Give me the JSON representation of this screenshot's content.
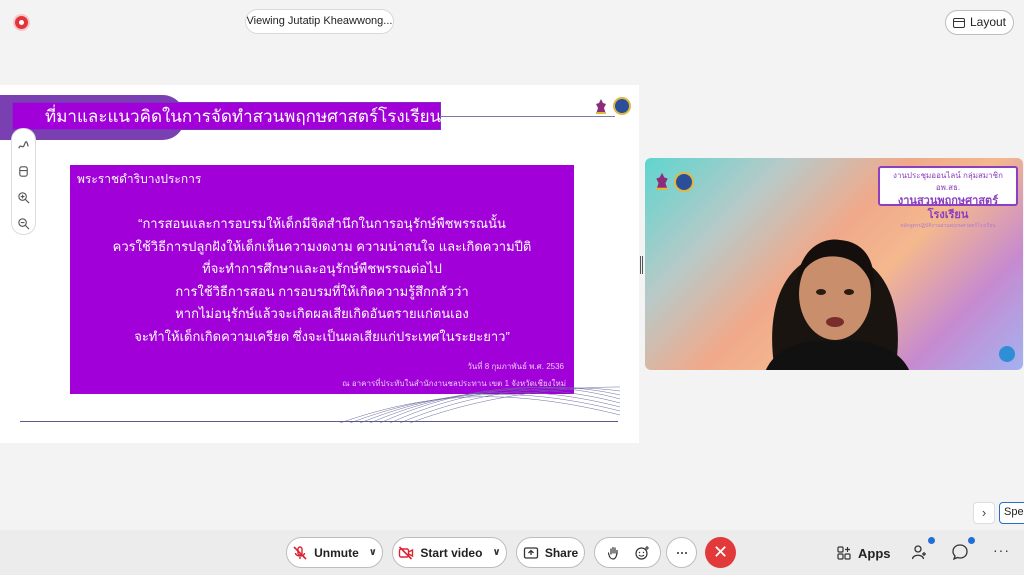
{
  "header": {
    "viewing_label": "Viewing Jutatip Kheawwong...",
    "layout_label": "Layout"
  },
  "slide": {
    "title": "ที่มาและแนวคิดในการจัดทำสวนพฤกษศาสตร์โรงเรียน",
    "quote_heading": "พระราชดำริบางประการ",
    "quote_lines": [
      "“การสอนและการอบรมให้เด็กมีจิตสำนึกในการอนุรักษ์พืชพรรณนั้น",
      "ควรใช้วิธีการปลูกฝังให้เด็กเห็นความงดงาม ความน่าสนใจ และเกิดความปีติ",
      "ที่จะทำการศึกษาและอนุรักษ์พืชพรรณต่อไป",
      "การใช้วิธีการสอน การอบรมที่ให้เกิดความรู้สึกกลัวว่า",
      "หากไม่อนุรักษ์แล้วจะเกิดผลเสียเกิดอันตรายแก่ตนเอง",
      "จะทำให้เด็กเกิดความเครียด ซึ่งจะเป็นผลเสียแก่ประเทศในระยะยาว”"
    ],
    "quote_date": "วันที่ 8 กุมภาพันธ์ พ.ศ. 2536",
    "quote_place": "ณ อาคารที่ประทับในสำนักงานชลประทาน เขต 1 จังหวัดเชียงใหม่"
  },
  "video": {
    "banner_line1": "งานประชุมออนไลน์ กลุ่มสมาชิก อพ.สธ.",
    "banner_line2": "งานสวนพฤกษศาสตร์โรงเรียน",
    "banner_line3": "หลักสูตรปฏิบัติงานสวนพฤกษศาสตร์โรงเรียน"
  },
  "speaker_label": "Speaker",
  "controls": {
    "unmute_label": "Unmute",
    "start_video_label": "Start video",
    "share_label": "Share",
    "apps_label": "Apps"
  },
  "colors": {
    "slide_purple": "#a100d8",
    "end_red": "#e23a3a",
    "accent_blue": "#1f6fd6"
  }
}
